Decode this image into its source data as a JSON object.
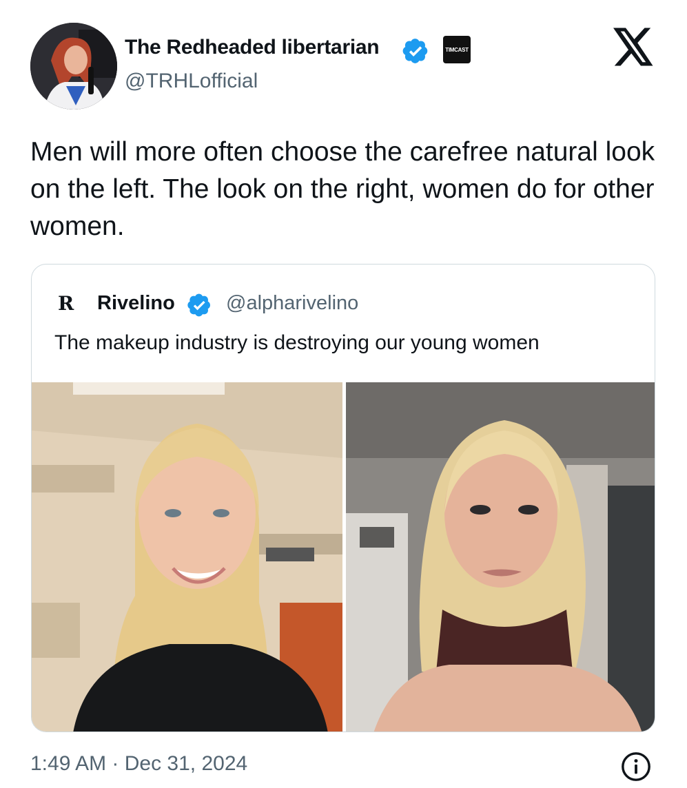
{
  "tweet": {
    "author": {
      "name": "The Redheaded libertarian",
      "handle": "@TRHLofficial",
      "affiliation_badge": "TIMCAST",
      "verified": true
    },
    "text": "Men will more often choose the carefree natural look on the left. The look on the right, women do for other women.",
    "timestamp": "1:49 AM · Dec 31, 2024"
  },
  "quoted_tweet": {
    "author": {
      "logo": "R",
      "name": "Rivelino",
      "handle": "@alpharivelino",
      "verified": true
    },
    "text": "The makeup industry is destroying our young women"
  },
  "icons": {
    "verified": "verified-badge-icon",
    "platform": "x-logo-icon",
    "info": "info-icon"
  },
  "colors": {
    "verified_blue": "#1d9bf0",
    "text_primary": "#0f1419",
    "text_secondary": "#536471",
    "border": "#cfd9de"
  }
}
